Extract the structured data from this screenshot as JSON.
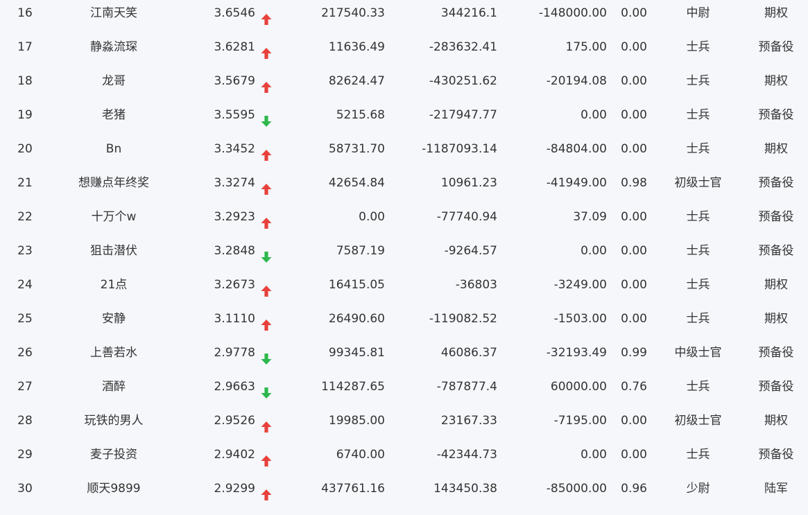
{
  "rows": [
    {
      "rank": "16",
      "name": "江南天笑",
      "score": "3.6546",
      "trend": "up",
      "v1": "217540.33",
      "v2": "344216.1",
      "v3": "-148000.00",
      "v4": "0.00",
      "title": "中尉",
      "category": "期权"
    },
    {
      "rank": "17",
      "name": "静淼流琛",
      "score": "3.6281",
      "trend": "up",
      "v1": "11636.49",
      "v2": "-283632.41",
      "v3": "175.00",
      "v4": "0.00",
      "title": "士兵",
      "category": "预备役"
    },
    {
      "rank": "18",
      "name": "龙哥",
      "score": "3.5679",
      "trend": "up",
      "v1": "82624.47",
      "v2": "-430251.62",
      "v3": "-20194.08",
      "v4": "0.00",
      "title": "士兵",
      "category": "期权"
    },
    {
      "rank": "19",
      "name": "老猪",
      "score": "3.5595",
      "trend": "down",
      "v1": "5215.68",
      "v2": "-217947.77",
      "v3": "0.00",
      "v4": "0.00",
      "title": "士兵",
      "category": "预备役"
    },
    {
      "rank": "20",
      "name": "Bn",
      "score": "3.3452",
      "trend": "up",
      "v1": "58731.70",
      "v2": "-1187093.14",
      "v3": "-84804.00",
      "v4": "0.00",
      "title": "士兵",
      "category": "期权"
    },
    {
      "rank": "21",
      "name": "想赚点年终奖",
      "score": "3.3274",
      "trend": "up",
      "v1": "42654.84",
      "v2": "10961.23",
      "v3": "-41949.00",
      "v4": "0.98",
      "title": "初级士官",
      "category": "预备役"
    },
    {
      "rank": "22",
      "name": "十万个w",
      "score": "3.2923",
      "trend": "up",
      "v1": "0.00",
      "v2": "-77740.94",
      "v3": "37.09",
      "v4": "0.00",
      "title": "士兵",
      "category": "预备役"
    },
    {
      "rank": "23",
      "name": "狙击潜伏",
      "score": "3.2848",
      "trend": "down",
      "v1": "7587.19",
      "v2": "-9264.57",
      "v3": "0.00",
      "v4": "0.00",
      "title": "士兵",
      "category": "预备役"
    },
    {
      "rank": "24",
      "name": "21点",
      "score": "3.2673",
      "trend": "up",
      "v1": "16415.05",
      "v2": "-36803",
      "v3": "-3249.00",
      "v4": "0.00",
      "title": "士兵",
      "category": "期权"
    },
    {
      "rank": "25",
      "name": "安静",
      "score": "3.1110",
      "trend": "up",
      "v1": "26490.60",
      "v2": "-119082.52",
      "v3": "-1503.00",
      "v4": "0.00",
      "title": "士兵",
      "category": "期权"
    },
    {
      "rank": "26",
      "name": "上善若水",
      "score": "2.9778",
      "trend": "down",
      "v1": "99345.81",
      "v2": "46086.37",
      "v3": "-32193.49",
      "v4": "0.99",
      "title": "中级士官",
      "category": "预备役"
    },
    {
      "rank": "27",
      "name": "酒醉",
      "score": "2.9663",
      "trend": "down",
      "v1": "114287.65",
      "v2": "-787877.4",
      "v3": "60000.00",
      "v4": "0.76",
      "title": "士兵",
      "category": "预备役"
    },
    {
      "rank": "28",
      "name": "玩铁的男人",
      "score": "2.9526",
      "trend": "up",
      "v1": "19985.00",
      "v2": "23167.33",
      "v3": "-7195.00",
      "v4": "0.00",
      "title": "初级士官",
      "category": "期权"
    },
    {
      "rank": "29",
      "name": "麦子投资",
      "score": "2.9402",
      "trend": "up",
      "v1": "6740.00",
      "v2": "-42344.73",
      "v3": "0.00",
      "v4": "0.00",
      "title": "士兵",
      "category": "预备役"
    },
    {
      "rank": "30",
      "name": "顺天9899",
      "score": "2.9299",
      "trend": "up",
      "v1": "437761.16",
      "v2": "143450.38",
      "v3": "-85000.00",
      "v4": "0.96",
      "title": "少尉",
      "category": "陆军"
    }
  ],
  "colors": {
    "up": "#e8413c",
    "down": "#2db84d",
    "text": "#333333",
    "background": "#f5f7fa"
  },
  "icons": {
    "up": "arrow-up-icon",
    "down": "arrow-down-icon"
  }
}
